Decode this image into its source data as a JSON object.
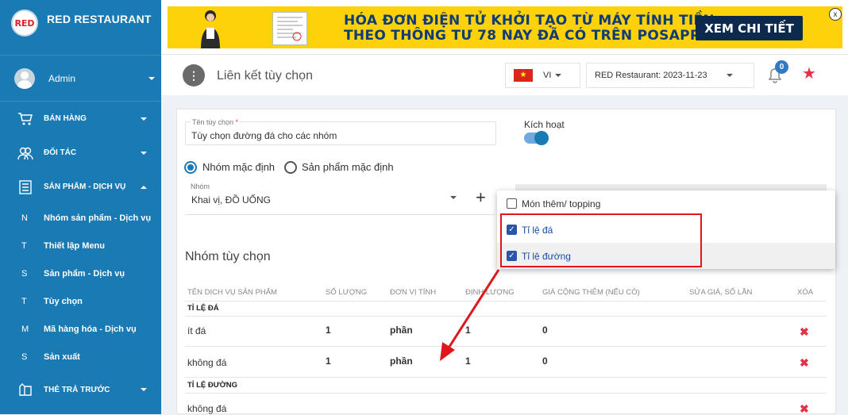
{
  "sidebar": {
    "brand": "RED RESTAURANT",
    "logo_text": "RED",
    "user": "Admin",
    "sections": [
      {
        "label": "BÁN HÀNG",
        "icon": "cart-icon"
      },
      {
        "label": "ĐỐI TÁC",
        "icon": "partners-icon"
      },
      {
        "label": "SẢN PHẨM - DỊCH VỤ",
        "icon": "products-icon"
      }
    ],
    "subitems": [
      {
        "letter": "N",
        "label": "Nhóm sản phẩm - Dịch vụ"
      },
      {
        "letter": "T",
        "label": "Thiết lập Menu"
      },
      {
        "letter": "S",
        "label": "Sản phẩm - Dịch vụ"
      },
      {
        "letter": "T",
        "label": "Tùy chọn"
      },
      {
        "letter": "M",
        "label": "Mã hàng hóa - Dịch vụ"
      },
      {
        "letter": "S",
        "label": "Sản xuất"
      }
    ],
    "last_section": {
      "label": "THẺ TRẢ TRƯỚC",
      "icon": "card-icon"
    }
  },
  "banner": {
    "line1": "HÓA ĐƠN ĐIỆN TỬ KHỞI TẠO TỪ MÁY TÍNH TIỀN",
    "line2": "THEO THÔNG TƯ 78 NAY ĐÃ CÓ TRÊN POSAPP",
    "button": "XEM CHI TIẾT",
    "close": "x"
  },
  "header": {
    "title": "Liên kết tùy chọn",
    "menu_glyph": "⋮",
    "language": "VI",
    "store": "RED Restaurant: 2023-11-23",
    "notification_count": "0"
  },
  "form": {
    "name_label": "Tên tùy chọn",
    "required_mark": "*",
    "name_value": "Tùy chọn đường đá cho các nhóm",
    "active_label": "Kích hoạt",
    "active": true,
    "radio_group": "Nhóm mặc định",
    "radio_product": "Sản phẩm mặc định",
    "group_label": "Nhóm",
    "group_value": "Khai vị, ĐỒ UỐNG",
    "add": "+"
  },
  "dropdown": {
    "items": [
      {
        "label": "Món thêm/ topping",
        "checked": false
      },
      {
        "label": "Tỉ lệ đá",
        "checked": true
      },
      {
        "label": "Tỉ lệ đường",
        "checked": true
      }
    ]
  },
  "table": {
    "section_title": "Nhóm tùy chọn",
    "headers": [
      "TÊN DỊCH VỤ SẢN PHẨM",
      "SỐ LƯỢNG",
      "ĐƠN VỊ TÍNH",
      "ĐỊNH LƯỢNG",
      "GIÁ CỘNG THÊM (NẾU CÓ)",
      "SỬA GIÁ, SỐ LẦN",
      "XÓA"
    ],
    "groups": [
      {
        "title": "TỈ LỆ ĐÁ",
        "rows": [
          {
            "name": "ít đá",
            "qty": "1",
            "unit": "phần",
            "amount": "1",
            "price": "0"
          },
          {
            "name": "không đá",
            "qty": "1",
            "unit": "phần",
            "amount": "1",
            "price": "0"
          }
        ]
      },
      {
        "title": "TỈ LỆ ĐƯỜNG",
        "rows": [
          {
            "name": "không đá"
          }
        ]
      }
    ],
    "delete_glyph": "✖"
  }
}
